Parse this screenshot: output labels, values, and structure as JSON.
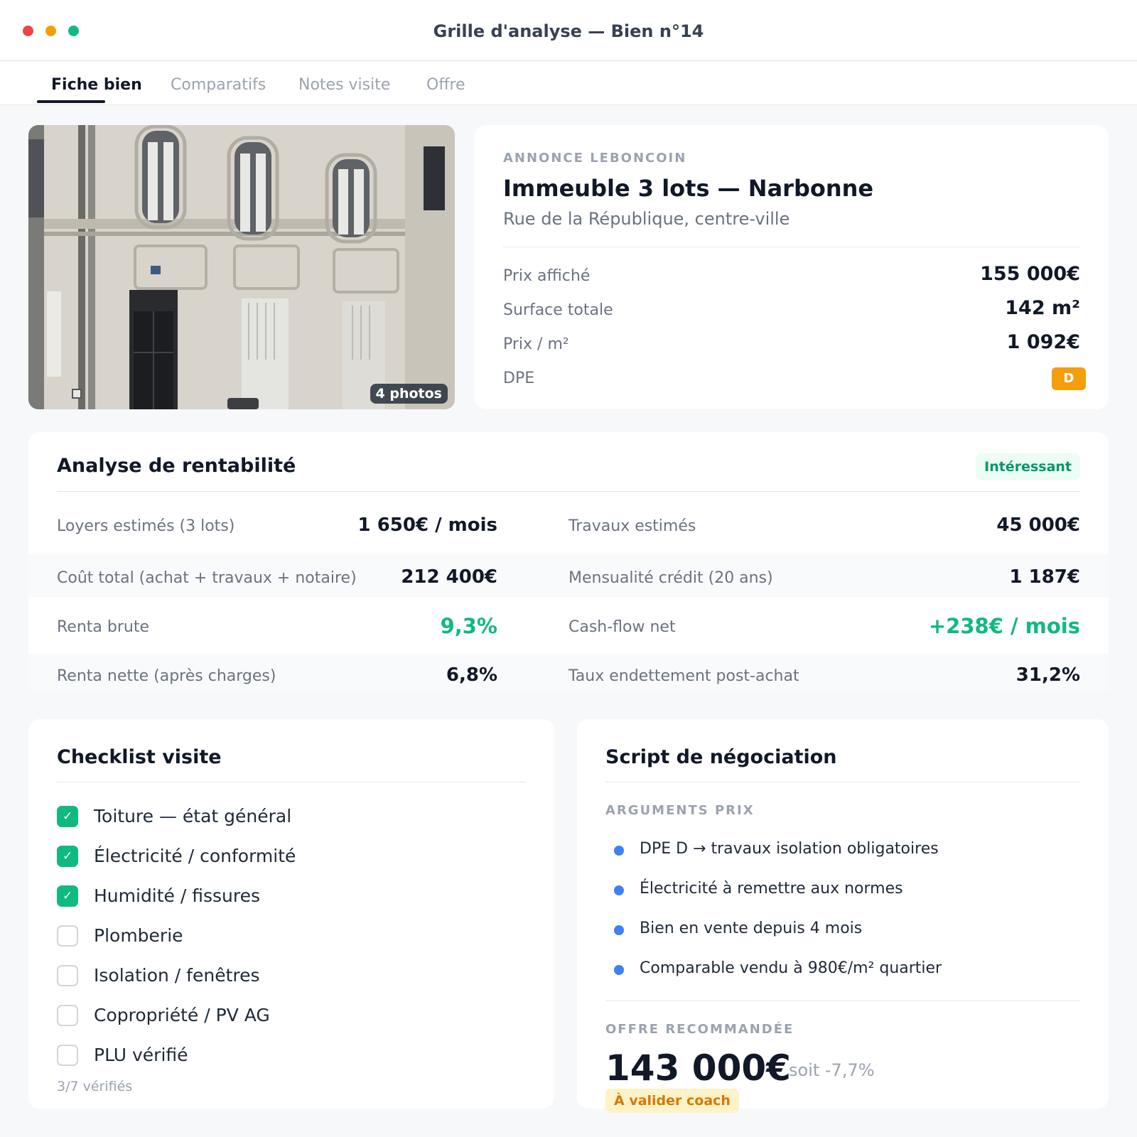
{
  "window": {
    "title": "Grille d'analyse — Bien n°14"
  },
  "tabs": [
    {
      "label": "Fiche bien",
      "active": true
    },
    {
      "label": "Comparatifs",
      "active": false
    },
    {
      "label": "Notes visite",
      "active": false
    },
    {
      "label": "Offre",
      "active": false
    }
  ],
  "photo": {
    "count_label": "4 photos"
  },
  "listing": {
    "source": "ANNONCE LEBONCOIN",
    "title": "Immeuble 3 lots — Narbonne",
    "address": "Rue de la République, centre-ville",
    "fields": [
      {
        "label": "Prix affiché",
        "value": "155 000€"
      },
      {
        "label": "Surface totale",
        "value": "142 m²"
      },
      {
        "label": "Prix / m²",
        "value": "1 092€"
      },
      {
        "label": "DPE",
        "value": "D"
      }
    ]
  },
  "analysis": {
    "title": "Analyse de rentabilité",
    "status": "Intéressant",
    "rows": [
      {
        "left_label": "Loyers estimés (3 lots)",
        "left_value": "1 650€ / mois",
        "right_label": "Travaux estimés",
        "right_value": "45 000€"
      },
      {
        "left_label": "Coût total (achat + travaux + notaire)",
        "left_value": "212 400€",
        "right_label": "Mensualité crédit (20 ans)",
        "right_value": "1 187€"
      },
      {
        "left_label": "Renta brute",
        "left_value": "9,3%",
        "right_label": "Cash-flow net",
        "right_value": "+238€ / mois"
      },
      {
        "left_label": "Renta nette (après charges)",
        "left_value": "6,8%",
        "right_label": "Taux endettement post-achat",
        "right_value": "31,2%"
      }
    ]
  },
  "checklist": {
    "title": "Checklist visite",
    "items": [
      {
        "label": "Toiture — état général",
        "checked": true
      },
      {
        "label": "Électricité / conformité",
        "checked": true
      },
      {
        "label": "Humidité / fissures",
        "checked": true
      },
      {
        "label": "Plomberie",
        "checked": false
      },
      {
        "label": "Isolation / fenêtres",
        "checked": false
      },
      {
        "label": "Copropriété / PV AG",
        "checked": false
      },
      {
        "label": "PLU vérifié",
        "checked": false
      }
    ],
    "summary": "3/7 vérifiés",
    "check_glyph": "✓"
  },
  "negotiation": {
    "title": "Script de négociation",
    "arguments_heading": "ARGUMENTS PRIX",
    "arguments": [
      "DPE D → travaux isolation obligatoires",
      "Électricité à remettre aux normes",
      "Bien en vente depuis 4 mois",
      "Comparable vendu à 980€/m² quartier"
    ],
    "offer_heading": "OFFRE RECOMMANDÉE",
    "offer_price": "143 000€",
    "offer_delta": "soit -7,7%",
    "offer_status": "À valider coach"
  },
  "colors": {
    "accent_green": "#10b981",
    "dpe_orange": "#f59e0b",
    "bullet_blue": "#3b82f6",
    "coach_amber": "#d97706"
  }
}
